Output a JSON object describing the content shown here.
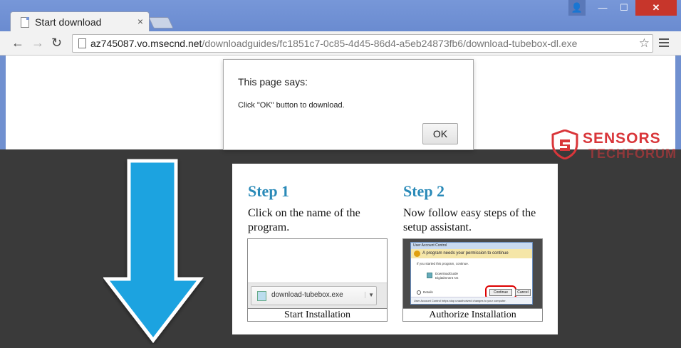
{
  "browser": {
    "tab_title": "Start download",
    "tab_close": "×",
    "url_host": "az745087.vo.msecnd.net",
    "url_path": "/downloadguides/fc1851c7-0c85-4d45-86d4-a5eb24873fb6/download-tubebox-dl.exe",
    "window_buttons": {
      "user": "👤",
      "min": "—",
      "max": "☐",
      "close": "✕"
    },
    "nav": {
      "back": "←",
      "forward": "→",
      "reload": "↻",
      "star": "☆"
    }
  },
  "dialog": {
    "title": "This page says:",
    "message": "Click \"OK\" button to download.",
    "ok_label": "OK"
  },
  "watermark": {
    "top": "SENSORS",
    "bottom": "TECHFORUM"
  },
  "card": {
    "step1": {
      "title": "Step 1",
      "text": "Click on the name of the program.",
      "caption": "Start Installation",
      "download_file": "download-tubebox.exe",
      "chevron": "▼"
    },
    "step2": {
      "title": "Step 2",
      "text": "Now follow easy steps of the setup assistant.",
      "caption": "Authorize Installation",
      "uac": {
        "title": "User Account Control",
        "warning": "A program needs your permission to continue",
        "line1": "If you started this program, continue.",
        "program": "DownloadGuide",
        "publisher": "Digitalmnent AG",
        "details": "Details",
        "continue": "Continue",
        "cancel": "Cancel",
        "footer": "User Account Control helps stop unauthorized changes to your computer."
      }
    }
  },
  "colors": {
    "titlebar": "#6a8bd0",
    "close_red": "#c7362b",
    "step_blue": "#2a8ab8",
    "arrow_blue": "#1aa3e0",
    "watermark_red": "#d9363a",
    "background": "#3a3a3a"
  }
}
